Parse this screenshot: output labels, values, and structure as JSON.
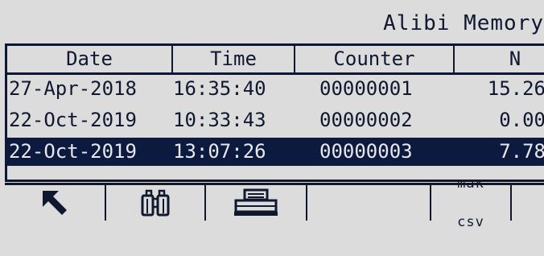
{
  "title": "Alibi Memory",
  "columns": [
    "Date",
    "Time",
    "Counter",
    "N"
  ],
  "rows": [
    {
      "date": "27-Apr-2018",
      "time": "16:35:40",
      "counter": "00000001",
      "value": "15.26",
      "selected": false
    },
    {
      "date": "22-Oct-2019",
      "time": "10:33:43",
      "counter": "00000002",
      "value": "0.00",
      "selected": false
    },
    {
      "date": "22-Oct-2019",
      "time": "13:07:26",
      "counter": "00000003",
      "value": "7.78",
      "selected": true
    }
  ],
  "softkeys": [
    {
      "icon": "back-arrow-icon"
    },
    {
      "icon": "binoculars-icon"
    },
    {
      "icon": "printer-icon"
    },
    {
      "icon": ""
    },
    {
      "label_line1": "maк",
      "label_line2": "csv"
    },
    {
      "icon": ""
    }
  ],
  "colors": {
    "background": "#dcdcdc",
    "foreground": "#101830",
    "selection": "#0d1a40"
  }
}
